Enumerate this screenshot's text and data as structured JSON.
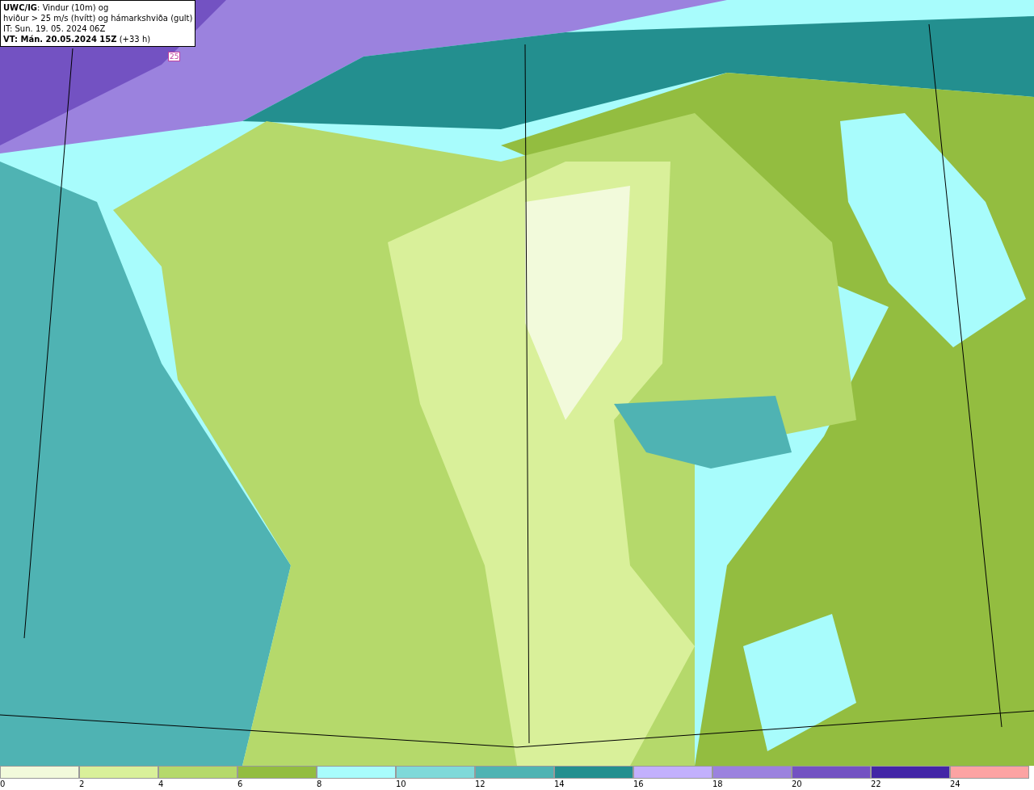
{
  "info_box": {
    "lines": [
      "**UWC/IG**: Vindur (10m) og",
      "hviður > 25 m/s (hvítt) og hámarkshviða (gult)",
      "IT: Sun. 19. 05. 2024 06Z",
      "**VT: Mán. 20.05.2024 15Z** (+33 h)"
    ]
  },
  "map": {
    "contour_label": "25"
  },
  "legend": {
    "swatches": [
      {
        "label": "0",
        "color": "#f2fadb"
      },
      {
        "label": "2",
        "color": "#d9f09a"
      },
      {
        "label": "4",
        "color": "#b5d96b"
      },
      {
        "label": "6",
        "color": "#93bd40"
      },
      {
        "label": "8",
        "color": "#a8fcfc"
      },
      {
        "label": "10",
        "color": "#7fd9d9"
      },
      {
        "label": "12",
        "color": "#4fb3b3"
      },
      {
        "label": "14",
        "color": "#238f8f"
      },
      {
        "label": "16",
        "color": "#c2b0fc"
      },
      {
        "label": "18",
        "color": "#9b82de"
      },
      {
        "label": "20",
        "color": "#7352c2"
      },
      {
        "label": "22",
        "color": "#4326a6"
      },
      {
        "label": "24",
        "color": "#fca3a3"
      }
    ]
  }
}
